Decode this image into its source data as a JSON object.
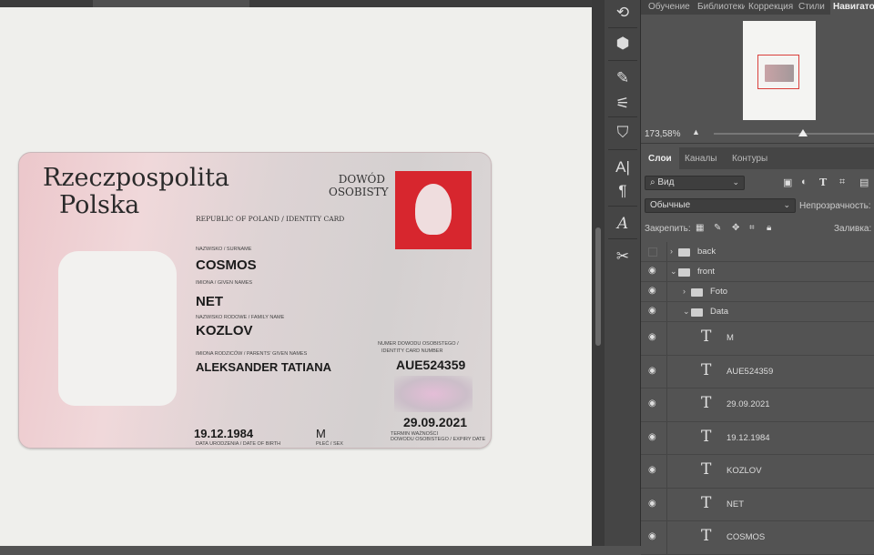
{
  "panel_tabs": [
    "Обучение",
    "Библиотеки",
    "Коррекция",
    "Стили",
    "Навигатор"
  ],
  "navigator": {
    "zoom": "173,58%",
    "zoom_slider_percent": 55
  },
  "layers_tabs": [
    "Слои",
    "Каналы",
    "Контуры"
  ],
  "filter": {
    "label": "Вид"
  },
  "blend_mode": "Обычные",
  "opacity_label": "Непрозрачность:",
  "lock_label": "Закрепить:",
  "fill_label": "Заливка:",
  "layers": [
    {
      "name": "back",
      "type": "group",
      "visible": false,
      "expanded": false
    },
    {
      "name": "front",
      "type": "group",
      "visible": true,
      "expanded": true
    },
    {
      "name": "Foto",
      "type": "group",
      "visible": true,
      "expanded": false
    },
    {
      "name": "Data",
      "type": "group",
      "visible": true,
      "expanded": true
    },
    {
      "name": "M",
      "type": "text",
      "visible": true
    },
    {
      "name": "AUE524359",
      "type": "text",
      "visible": true
    },
    {
      "name": "29.09.2021",
      "type": "text",
      "visible": true
    },
    {
      "name": "19.12.1984",
      "type": "text",
      "visible": true
    },
    {
      "name": "KOZLOV",
      "type": "text",
      "visible": true
    },
    {
      "name": "NET",
      "type": "text",
      "visible": true
    },
    {
      "name": "COSMOS",
      "type": "text",
      "visible": true
    }
  ],
  "card": {
    "title1": "Rzeczpospolita",
    "title2": "Polska",
    "doc1": "DOWÓD",
    "doc2": "OSOBISTY",
    "subtitle": "REPUBLIC OF POLAND / IDENTITY CARD",
    "surname_label": "NAZWISKO / SURNAME",
    "surname": "COSMOS",
    "given_label": "IMIONA / GIVEN NAMES",
    "given": "NET",
    "family_label": "NAZWISKO RODOWE / FAMILY NAME",
    "family": "KOZLOV",
    "parents_label": "IMIONA RODZICÓW / PARENTS' GIVEN NAMES",
    "parents": "ALEKSANDER TATIANA",
    "number_label1": "NUMER DOWODU OSOBISTEGO /",
    "number_label2": "IDENTITY CARD NUMBER",
    "number": "AUE524359",
    "dob": "19.12.1984",
    "dob_label": "DATA URODZENIA / DATE OF BIRTH",
    "sex": "M",
    "sex_label": "PŁEĆ / SEX",
    "expiry": "29.09.2021",
    "expiry_label1": "TERMIN WAŻNOŚCI",
    "expiry_label2": "DOWODU OSOBISTEGO / EXPIRY DATE"
  },
  "colors": {
    "panel": "#535353",
    "emblem": "#d7262e",
    "nav_rect": "#d9403c"
  }
}
